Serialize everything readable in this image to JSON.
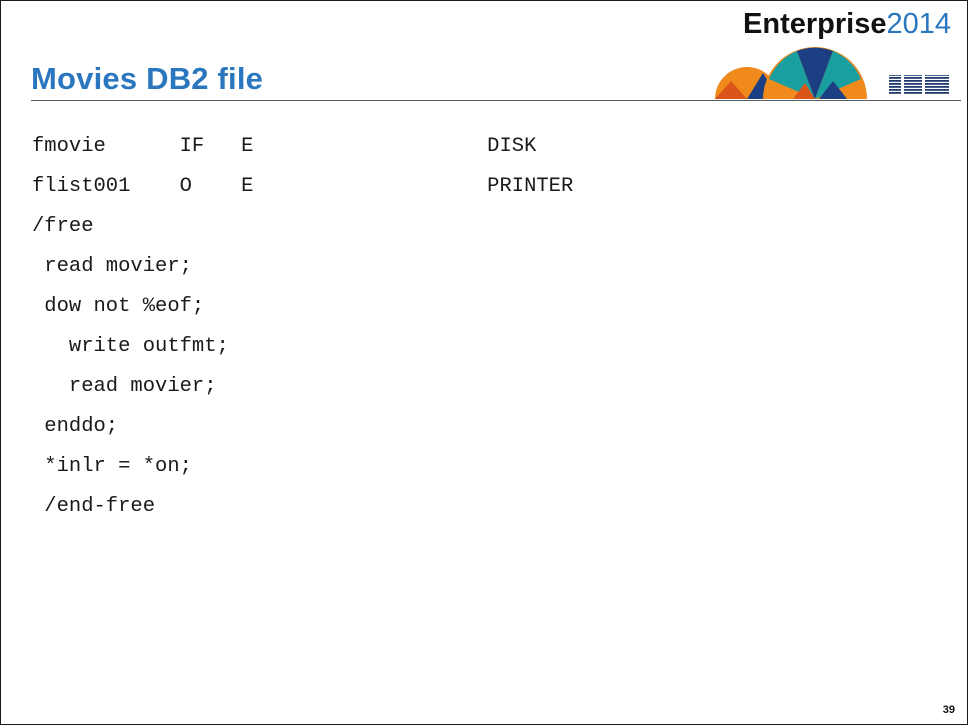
{
  "slide": {
    "title": "Movies DB2 file",
    "brand": {
      "name": "Enterprise",
      "year": "2014",
      "logo_icon": "enterprise-sunburst-icon",
      "ibm_logo": "IBM",
      "colors": {
        "orange": "#f08a1c",
        "deep_orange": "#d9551a",
        "teal": "#1a9fa0",
        "navy": "#1c3e82",
        "accent_blue": "#2a77c0"
      }
    },
    "code_lines": [
      "fmovie      IF   E                   DISK",
      "flist001    O    E                   PRINTER",
      "/free",
      " read movier;",
      " dow not %eof;",
      "   write outfmt;",
      "   read movier;",
      " enddo;",
      " *inlr = *on;",
      " /end-free"
    ],
    "page_number": "39"
  }
}
